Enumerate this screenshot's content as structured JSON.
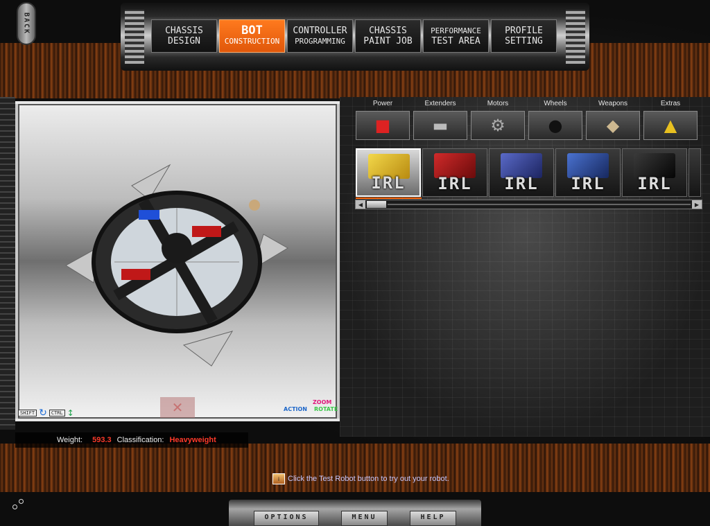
{
  "back": {
    "label": "BACK"
  },
  "nav": {
    "tabs": [
      {
        "line1": "CHASSIS",
        "line2": "DESIGN",
        "active": false
      },
      {
        "line1": "BOT",
        "line2": "CONSTRUCTION",
        "active": true
      },
      {
        "line1": "CONTROLLER",
        "line2": "PROGRAMMING",
        "active": false
      },
      {
        "line1": "CHASSIS",
        "line2": "PAINT JOB",
        "active": false
      },
      {
        "line1": "PERFORMANCE",
        "line2": "TEST AREA",
        "active": false
      },
      {
        "line1": "PROFILE",
        "line2": "SETTING",
        "active": false
      }
    ]
  },
  "viewport": {
    "controls": {
      "shift": "SHIFT",
      "ctrl": "CTRL"
    },
    "legend": {
      "zoom": "ZOOM",
      "action": "ACTION",
      "rotate": "ROTATE"
    }
  },
  "categories": [
    {
      "label": "Power",
      "icon": "battery-icon"
    },
    {
      "label": "Extenders",
      "icon": "extender-icon"
    },
    {
      "label": "Motors",
      "icon": "motor-icon"
    },
    {
      "label": "Wheels",
      "icon": "wheel-icon"
    },
    {
      "label": "Weapons",
      "icon": "weapon-icon"
    },
    {
      "label": "Extras",
      "icon": "extras-icon"
    }
  ],
  "items": [
    {
      "label": "IRL",
      "color": "#e8c020",
      "selected": true
    },
    {
      "label": "IRL",
      "color": "#b01818",
      "selected": false
    },
    {
      "label": "IRL",
      "color": "#3a4aa0",
      "selected": false
    },
    {
      "label": "IRL",
      "color": "#2a4fa8",
      "selected": false
    },
    {
      "label": "IRL",
      "color": "#1a1a1a",
      "selected": false
    }
  ],
  "stats": {
    "weight_label": "Weight:",
    "weight_value": "593.3",
    "class_label": "Classification:",
    "class_value": "Heavyweight"
  },
  "hint": {
    "text": "Click the Test Robot button to try out your robot."
  },
  "bottom": {
    "options": "OPTIONS",
    "menu": "MENU",
    "help": "HELP"
  },
  "colors": {
    "accent": "#ff6a10",
    "stat_value": "#ff3a2a"
  }
}
